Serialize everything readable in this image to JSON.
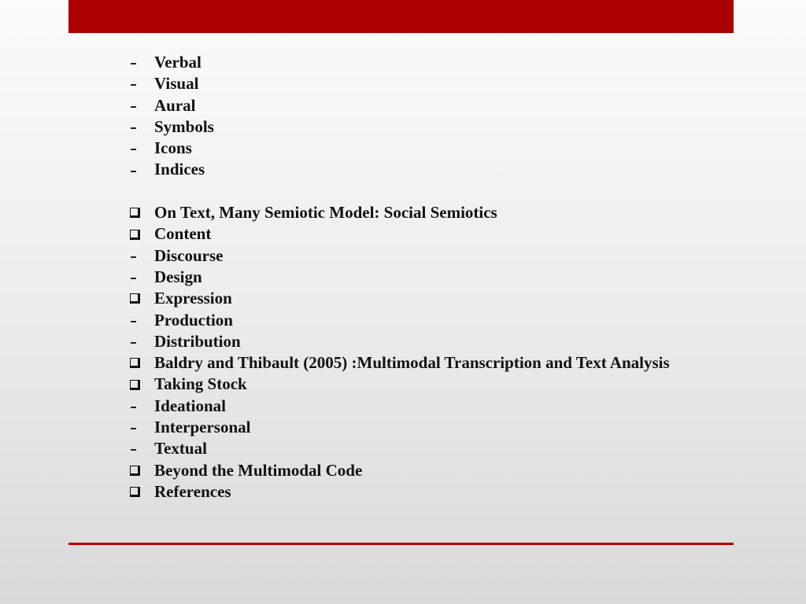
{
  "slide": {
    "accent_color": "#aa0000",
    "items": [
      {
        "type": "dash",
        "text": "Verbal"
      },
      {
        "type": "dash",
        "text": "Visual"
      },
      {
        "type": "dash",
        "text": "Aural"
      },
      {
        "type": "dash",
        "text": "Symbols"
      },
      {
        "type": "dash",
        "text": "Icons"
      },
      {
        "type": "dash",
        "text": "Indices"
      },
      {
        "type": "spacer",
        "text": ""
      },
      {
        "type": "box",
        "text": "On Text, Many Semiotic Model: Social Semiotics"
      },
      {
        "type": "box",
        "text": "Content"
      },
      {
        "type": "dash",
        "text": "Discourse"
      },
      {
        "type": "dash",
        "text": "Design"
      },
      {
        "type": "box",
        "text": "Expression"
      },
      {
        "type": "dash",
        "text": "Production"
      },
      {
        "type": "dash",
        "text": "Distribution"
      },
      {
        "type": "box",
        "text": "Baldry and Thibault (2005) :Multimodal Transcription and Text Analysis"
      },
      {
        "type": "box",
        "text": "Taking Stock"
      },
      {
        "type": "dash",
        "text": "Ideational"
      },
      {
        "type": "dash",
        "text": "Interpersonal"
      },
      {
        "type": "dash",
        "text": "Textual"
      },
      {
        "type": "box",
        "text": "Beyond the Multimodal Code"
      },
      {
        "type": "box",
        "text": "References"
      }
    ]
  }
}
